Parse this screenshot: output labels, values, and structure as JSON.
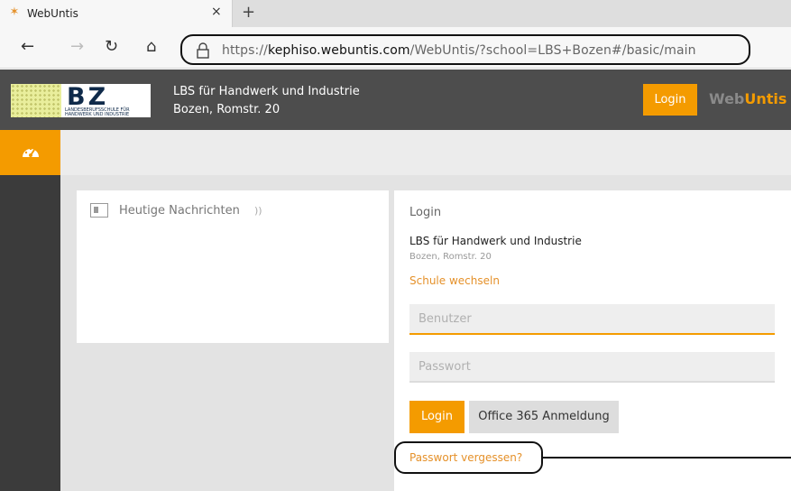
{
  "browser": {
    "tab_title": "WebUntis",
    "tab_close": "×",
    "new_tab": "+",
    "url_prefix": "https://",
    "url_domain": "kephiso.webuntis.com",
    "url_path": "/WebUntis/?school=LBS+Bozen#/basic/main",
    "nav": {
      "back": "←",
      "forward": "→",
      "refresh": "↻",
      "home": "⌂"
    }
  },
  "header": {
    "logo_text": "BZ",
    "logo_subtext_1": "LANDESBERUFSSCHULE FÜR",
    "logo_subtext_2": "HANDWERK UND INDUSTRIE",
    "school_name": "LBS für Handwerk und Industrie",
    "school_address": "Bozen, Romstr. 20",
    "login_button": "Login",
    "brand_prefix": "Web",
    "brand_suffix": "Untis"
  },
  "sidebar": {
    "items": [
      {
        "icon": "dashboard-icon",
        "active": true
      }
    ]
  },
  "news": {
    "title": "Heutige Nachrichten",
    "icon": "newspaper-icon",
    "feed_icon": "rss-icon"
  },
  "login": {
    "title": "Login",
    "school_name": "LBS für Handwerk und Industrie",
    "school_address": "Bozen, Romstr. 20",
    "change_school": "Schule wechseln",
    "username_placeholder": "Benutzer",
    "password_placeholder": "Passwort",
    "login_button": "Login",
    "office_button": "Office 365 Anmeldung",
    "forgot_password": "Passwort vergessen?"
  },
  "colors": {
    "accent": "#f49b00",
    "header_bg": "#4d4d4d",
    "rail_bg": "#3b3b3b"
  }
}
